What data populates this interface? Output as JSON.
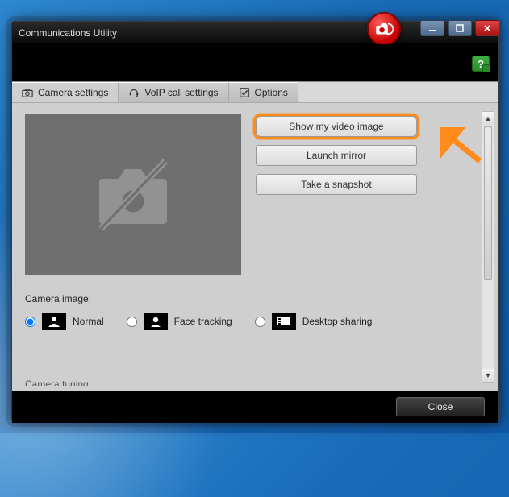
{
  "window": {
    "title": "Communications Utility"
  },
  "tabs": [
    {
      "label": "Camera settings"
    },
    {
      "label": "VoIP call settings"
    },
    {
      "label": "Options"
    }
  ],
  "buttons": {
    "show_video": "Show my video image",
    "launch_mirror": "Launch mirror",
    "take_snapshot": "Take a snapshot"
  },
  "camera_image": {
    "section_label": "Camera image:",
    "options": [
      {
        "label": "Normal"
      },
      {
        "label": "Face tracking"
      },
      {
        "label": "Desktop sharing"
      }
    ],
    "selected_index": 0
  },
  "truncated_label": "Camera tuning",
  "footer": {
    "close": "Close"
  },
  "help_glyph": "?",
  "colors": {
    "highlight": "#ff8c1a"
  }
}
